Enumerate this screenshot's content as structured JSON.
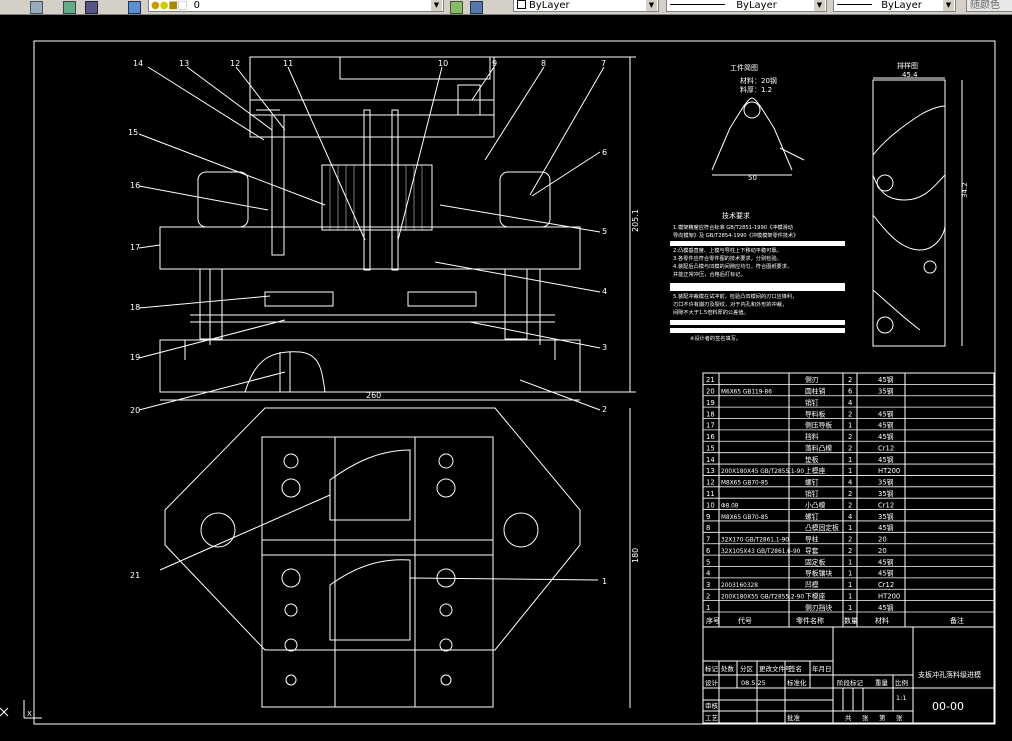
{
  "toolbar": {
    "layer_value": "0",
    "color_value": "ByLayer",
    "linetype_value": "ByLayer",
    "lineweight_value": "ByLayer",
    "plotstyle_value": "随颜色"
  },
  "drawing": {
    "overall_dims": {
      "height_top": "205.1",
      "width_top": "260",
      "height_plan": "180"
    },
    "balloons_left": [
      "14",
      "13",
      "12",
      "11",
      "10",
      "9",
      "8",
      "7",
      "15",
      "16",
      "17",
      "18",
      "19",
      "20",
      "21"
    ],
    "balloons_right": [
      "6",
      "5",
      "4",
      "3",
      "2",
      "1"
    ],
    "part_panel": {
      "title": "工件简图",
      "material": "材料：20钢",
      "thickness": "料厚：1.2",
      "dim_width": "50"
    },
    "layout_panel": {
      "title": "排样图",
      "dim_pitch": "45.4",
      "dim_height": "34.2"
    },
    "tech_req": {
      "title": "技术要求",
      "lines": [
        "1.模架精度应符合标准 GB/T2851-1990《冲模滑动",
        "  导向模架》及 GB/T2854-1990《冲模模架零件技术》",
        "2.凸模垂直度、上模与导柱上下移动平稳可靠。",
        "3.各零件应符合零件图的技术要求，分别检验。",
        "4.装配后凸模与凹模的间隙应均匀，符合图纸要求，",
        "  并能正常冲压，合格后打标记。",
        "5.装配冲裁模在试冲前，检验凸凹模间的刃口应锋利，",
        "  刃口不许有崩刃及裂纹，对于内孔和外形的冲裁，",
        "  间隙不大于1.5倍料厚的公差值。"
      ],
      "note": "※设计者的签名填写。"
    }
  },
  "bom": {
    "headers": {
      "no": "序号",
      "code": "代号",
      "name": "零件名称",
      "qty": "数量",
      "material": "材料",
      "remark": "备注"
    },
    "rows": [
      {
        "no": "21",
        "code": "",
        "name": "侧刃",
        "qty": "2",
        "material": "45钢"
      },
      {
        "no": "20",
        "code": "M6X65  GB119-86",
        "name": "圆柱销",
        "qty": "6",
        "material": "35钢"
      },
      {
        "no": "19",
        "code": "",
        "name": "销钉",
        "qty": "4",
        "material": ""
      },
      {
        "no": "18",
        "code": "",
        "name": "导料板",
        "qty": "2",
        "material": "45钢"
      },
      {
        "no": "17",
        "code": "",
        "name": "侧压导板",
        "qty": "1",
        "material": "45钢"
      },
      {
        "no": "16",
        "code": "",
        "name": "挡料",
        "qty": "2",
        "material": "45钢"
      },
      {
        "no": "15",
        "code": "",
        "name": "落料凸模",
        "qty": "2",
        "material": "Cr12"
      },
      {
        "no": "14",
        "code": "",
        "name": "垫板",
        "qty": "1",
        "material": "45钢"
      },
      {
        "no": "13",
        "code": "200X180X45 GB/T2855.1-90",
        "name": "上模座",
        "qty": "1",
        "material": "HT200"
      },
      {
        "no": "12",
        "code": "M8X65  GB70-85",
        "name": "螺钉",
        "qty": "4",
        "material": "35钢"
      },
      {
        "no": "11",
        "code": "",
        "name": "销钉",
        "qty": "2",
        "material": "35钢"
      },
      {
        "no": "10",
        "code": "Φ8.08",
        "name": "小凸模",
        "qty": "2",
        "material": "Cr12"
      },
      {
        "no": "9",
        "code": "M8X65  GB70-85",
        "name": "螺钉",
        "qty": "4",
        "material": "35钢"
      },
      {
        "no": "8",
        "code": "",
        "name": "凸模固定板",
        "qty": "1",
        "material": "45钢"
      },
      {
        "no": "7",
        "code": "32X170 GB/T2861.1-90",
        "name": "导柱",
        "qty": "2",
        "material": "20"
      },
      {
        "no": "6",
        "code": "32X105X43 GB/T2861.6-90",
        "name": "导套",
        "qty": "2",
        "material": "20"
      },
      {
        "no": "5",
        "code": "",
        "name": "固定板",
        "qty": "1",
        "material": "45钢"
      },
      {
        "no": "4",
        "code": "",
        "name": "导板镶块",
        "qty": "1",
        "material": "45钢"
      },
      {
        "no": "3",
        "code": "2003160328",
        "name": "凹模",
        "qty": "1",
        "material": "Cr12"
      },
      {
        "no": "2",
        "code": "200X180X55 GB/T2855.2-90",
        "name": "下模座",
        "qty": "1",
        "material": "HT200"
      },
      {
        "no": "1",
        "code": "",
        "name": "侧刃挡块",
        "qty": "1",
        "material": "45钢"
      }
    ]
  },
  "title_block": {
    "labels": {
      "mark": "标记",
      "count": "处数",
      "zone": "分区",
      "change_doc": "更改文件号",
      "sign": "签名",
      "date": "年月日",
      "design": "设计",
      "standardize": "标准化",
      "stage_mark": "阶段标记",
      "weight": "重量",
      "scale": "比例",
      "review": "审核",
      "process": "工艺",
      "approve": "批准",
      "sheets_total": "共",
      "sheet_unit1": "张",
      "sheet_no": "第",
      "sheet_unit2": "张"
    },
    "design_date": "08.5.25",
    "scale_value": "1:1",
    "drawing_title": "支板冲孔落料级进模",
    "drawing_no": "00-00"
  }
}
